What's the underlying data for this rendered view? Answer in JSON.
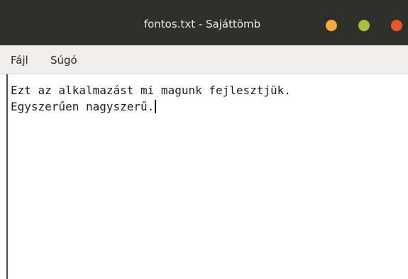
{
  "window": {
    "title": "fontos.txt - Sajáttömb"
  },
  "menu": {
    "items": [
      {
        "label": "Fájl"
      },
      {
        "label": "Súgó"
      }
    ]
  },
  "editor": {
    "lines": [
      "Ezt az alkalmazást mi magunk fejlesztjük.",
      "Egyszerűen nagyszerű."
    ]
  },
  "colors": {
    "titlebar": "#2f2f2c",
    "minimize": "#f7a93c",
    "maximize": "#a9c23b",
    "close": "#e9562c",
    "menubar": "#efeeec"
  },
  "icons": {
    "minimize": "minimize-button-dot",
    "maximize": "maximize-button-dot",
    "close": "close-button-dot"
  }
}
